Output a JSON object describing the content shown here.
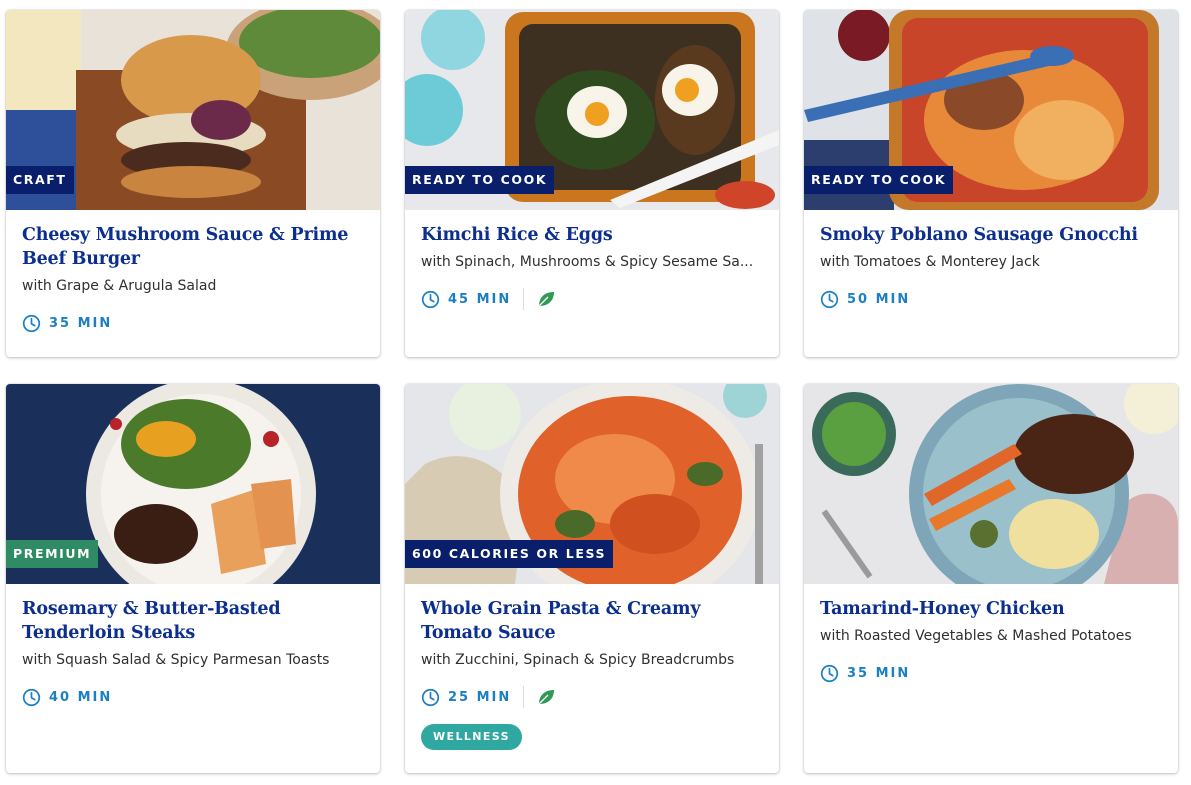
{
  "colors": {
    "title": "#0c2f8f",
    "time": "#1b7fc4",
    "tag_navy": "#0a1f6b",
    "tag_green": "#2e8b63",
    "wellness": "#2fa8a2",
    "leaf": "#2e9a54"
  },
  "cards": [
    {
      "tag": "CRAFT",
      "title": "Cheesy Mushroom Sauce & Prime Beef Burger",
      "subtitle": "with Grape & Arugula Salad",
      "time": "35 MIN",
      "icons": [
        "clock-icon"
      ]
    },
    {
      "tag": "READY TO COOK",
      "title": "Kimchi Rice & Eggs",
      "subtitle": "with Spinach, Mushrooms & Spicy Sesame Sa...",
      "time": "45 MIN",
      "icons": [
        "clock-icon",
        "leaf-icon"
      ]
    },
    {
      "tag": "READY TO COOK",
      "title": "Smoky Poblano Sausage Gnocchi",
      "subtitle": "with Tomatoes & Monterey Jack",
      "time": "50 MIN",
      "icons": [
        "clock-icon"
      ]
    },
    {
      "tag": "PREMIUM",
      "title": "Rosemary & Butter-Basted Tenderloin Steaks",
      "subtitle": "with Squash Salad & Spicy Parmesan Toasts",
      "time": "40 MIN",
      "icons": [
        "clock-icon"
      ]
    },
    {
      "tag": "600 CALORIES OR LESS",
      "title": "Whole Grain Pasta & Creamy Tomato Sauce",
      "subtitle": "with Zucchini, Spinach & Spicy Breadcrumbs",
      "time": "25 MIN",
      "badge": "WELLNESS",
      "icons": [
        "clock-icon",
        "leaf-icon"
      ]
    },
    {
      "title": "Tamarind-Honey Chicken",
      "subtitle": "with Roasted Vegetables & Mashed Potatoes",
      "time": "35 MIN",
      "icons": [
        "clock-icon"
      ]
    }
  ]
}
